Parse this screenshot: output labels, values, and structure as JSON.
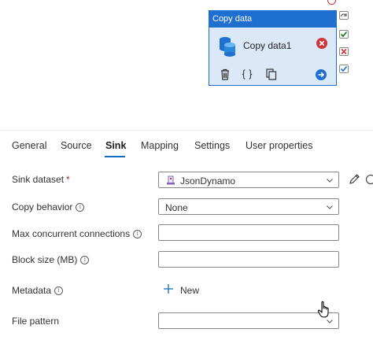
{
  "activity": {
    "header": "Copy data",
    "name": "Copy data1",
    "icons": [
      "database-icon",
      "error-icon",
      "delete-icon",
      "code-icon",
      "copy-icon",
      "go-icon"
    ],
    "accent": "#1f6fd1",
    "body_color": "#dbe8f8"
  },
  "connectors": [
    "skip-icon",
    "success-check-icon",
    "failure-x-icon",
    "completion-check-icon"
  ],
  "tabs": [
    {
      "label": "General"
    },
    {
      "label": "Source"
    },
    {
      "label": "Sink",
      "active": true
    },
    {
      "label": "Mapping"
    },
    {
      "label": "Settings"
    },
    {
      "label": "User properties"
    }
  ],
  "form": {
    "sink_dataset": {
      "label": "Sink dataset",
      "required_mark": "*",
      "value": "JsonDynamo"
    },
    "copy_behavior": {
      "label": "Copy behavior",
      "info": "i",
      "value": "None"
    },
    "max_concurrent": {
      "label": "Max concurrent connections",
      "info": "i",
      "value": ""
    },
    "block_size": {
      "label": "Block size (MB)",
      "info": "i",
      "value": ""
    },
    "metadata": {
      "label": "Metadata",
      "info": "i",
      "new_button": "New"
    },
    "file_pattern": {
      "label": "File pattern",
      "value": ""
    }
  },
  "colors": {
    "tab_underline": "#0f6cbd",
    "required": "#a4262c",
    "error": "#d13438",
    "success": "#107c10"
  }
}
